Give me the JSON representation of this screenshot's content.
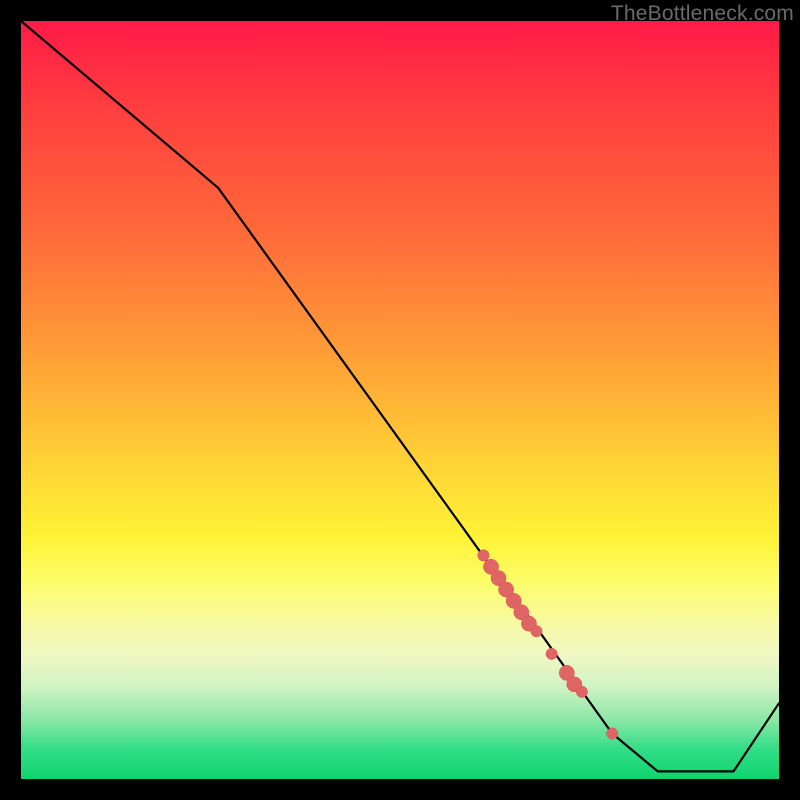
{
  "watermark": "TheBottleneck.com",
  "colors": {
    "frame": "#000000",
    "line": "#000000",
    "marker": "#e06666",
    "marker_stroke": "#d94f4f"
  },
  "chart_data": {
    "type": "line",
    "title": "",
    "xlabel": "",
    "ylabel": "",
    "xlim": [
      0,
      100
    ],
    "ylim": [
      0,
      100
    ],
    "grid": false,
    "series": [
      {
        "name": "curve",
        "x": [
          0,
          26,
          62,
          68,
          73,
          78,
          84,
          94,
          100
        ],
        "y": [
          100,
          78,
          28,
          20,
          13,
          6,
          1,
          1,
          10
        ]
      }
    ],
    "markers": {
      "comment": "highlighted points / clusters on the descending slope",
      "points": [
        {
          "x": 61,
          "y": 29.5,
          "r": 3
        },
        {
          "x": 62,
          "y": 28.0,
          "r": 4
        },
        {
          "x": 63,
          "y": 26.5,
          "r": 4
        },
        {
          "x": 64,
          "y": 25.0,
          "r": 4
        },
        {
          "x": 65,
          "y": 23.5,
          "r": 4
        },
        {
          "x": 66,
          "y": 22.0,
          "r": 4
        },
        {
          "x": 67,
          "y": 20.5,
          "r": 4
        },
        {
          "x": 68,
          "y": 19.5,
          "r": 3
        },
        {
          "x": 70,
          "y": 16.5,
          "r": 3
        },
        {
          "x": 72,
          "y": 14.0,
          "r": 4
        },
        {
          "x": 73,
          "y": 12.5,
          "r": 4
        },
        {
          "x": 74,
          "y": 11.5,
          "r": 3
        },
        {
          "x": 78,
          "y": 6.0,
          "r": 3
        }
      ]
    }
  }
}
